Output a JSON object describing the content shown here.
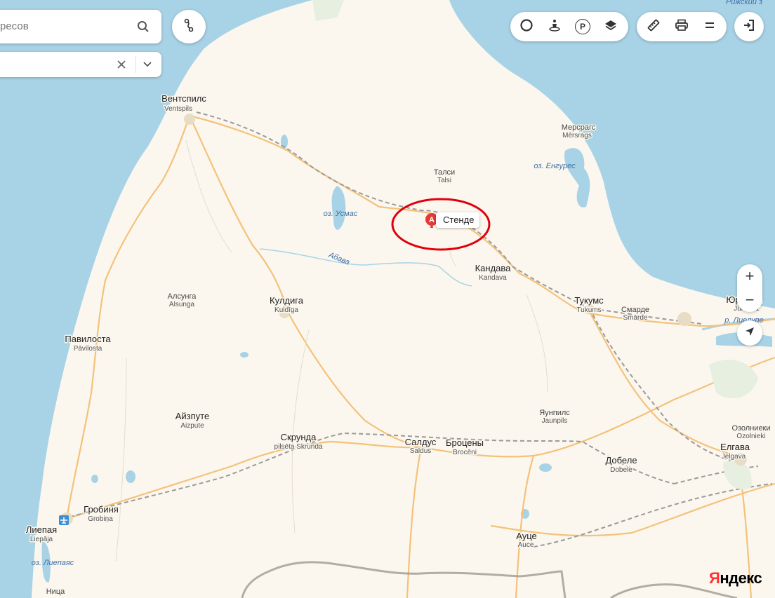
{
  "search": {
    "placeholder": "ресов"
  },
  "route": {
    "value": ""
  },
  "toolbar": {
    "traffic": "traffic-icon",
    "panorama": "panorama-icon",
    "parking": "P",
    "layers": "layers-icon",
    "ruler": "ruler-icon",
    "print": "print-icon",
    "menu": "menu-icon",
    "login": "login-icon"
  },
  "zoom": {
    "in": "+",
    "out": "−"
  },
  "marker": {
    "letter": "A",
    "label": "Стенде",
    "color": "#e53935"
  },
  "highlight": {
    "color": "#e0000d"
  },
  "cities": [
    {
      "name": "Вентспилс",
      "sub": "Ventspils"
    },
    {
      "name": "Мерсрагс",
      "sub": "Mērsrags"
    },
    {
      "name": "Талси",
      "sub": "Talsi"
    },
    {
      "name": "Кандава",
      "sub": "Kandava"
    },
    {
      "name": "Тукумс",
      "sub": "Tukums"
    },
    {
      "name": "Смарде",
      "sub": "Smārde"
    },
    {
      "name": "Юрмала",
      "sub": "Jūrmala"
    },
    {
      "name": "Алсунга",
      "sub": "Alsunga"
    },
    {
      "name": "Кулдига",
      "sub": "Kuldīga"
    },
    {
      "name": "Павилоста",
      "sub": "Pāvilosta"
    },
    {
      "name": "Айзпуте",
      "sub": "Aizpute"
    },
    {
      "name": "Скрунда",
      "sub": "pilsēta Skrunda"
    },
    {
      "name": "Салдус",
      "sub": "Saldus"
    },
    {
      "name": "Броцены",
      "sub": "Brocēni"
    },
    {
      "name": "Яунпилс",
      "sub": "Jaunpils"
    },
    {
      "name": "Озолниеки",
      "sub": "Ozolnieki"
    },
    {
      "name": "Елгава",
      "sub": "Jelgava"
    },
    {
      "name": "Добеле",
      "sub": "Dobele"
    },
    {
      "name": "Гробиня",
      "sub": "Grobiņa"
    },
    {
      "name": "Лиепая",
      "sub": "Liepāja"
    },
    {
      "name": "Ауце",
      "sub": "Auce"
    },
    {
      "name": "Ница",
      "sub": "Nīca"
    }
  ],
  "water": {
    "engure": "оз. Енгурес",
    "usmas": "оз. Усмас",
    "abava": "Абава",
    "liepajas": "оз. Лиепаяс",
    "lielupe": "р. Лиелупе",
    "gulf": "Рижский з"
  },
  "logo": {
    "first": "Я",
    "rest": "ндекс"
  },
  "colors": {
    "sea": "#a8d3e6",
    "land": "#fbf7ee",
    "road": "#f4c27a",
    "rail": "#9a9a9a",
    "border": "#a09a90"
  }
}
